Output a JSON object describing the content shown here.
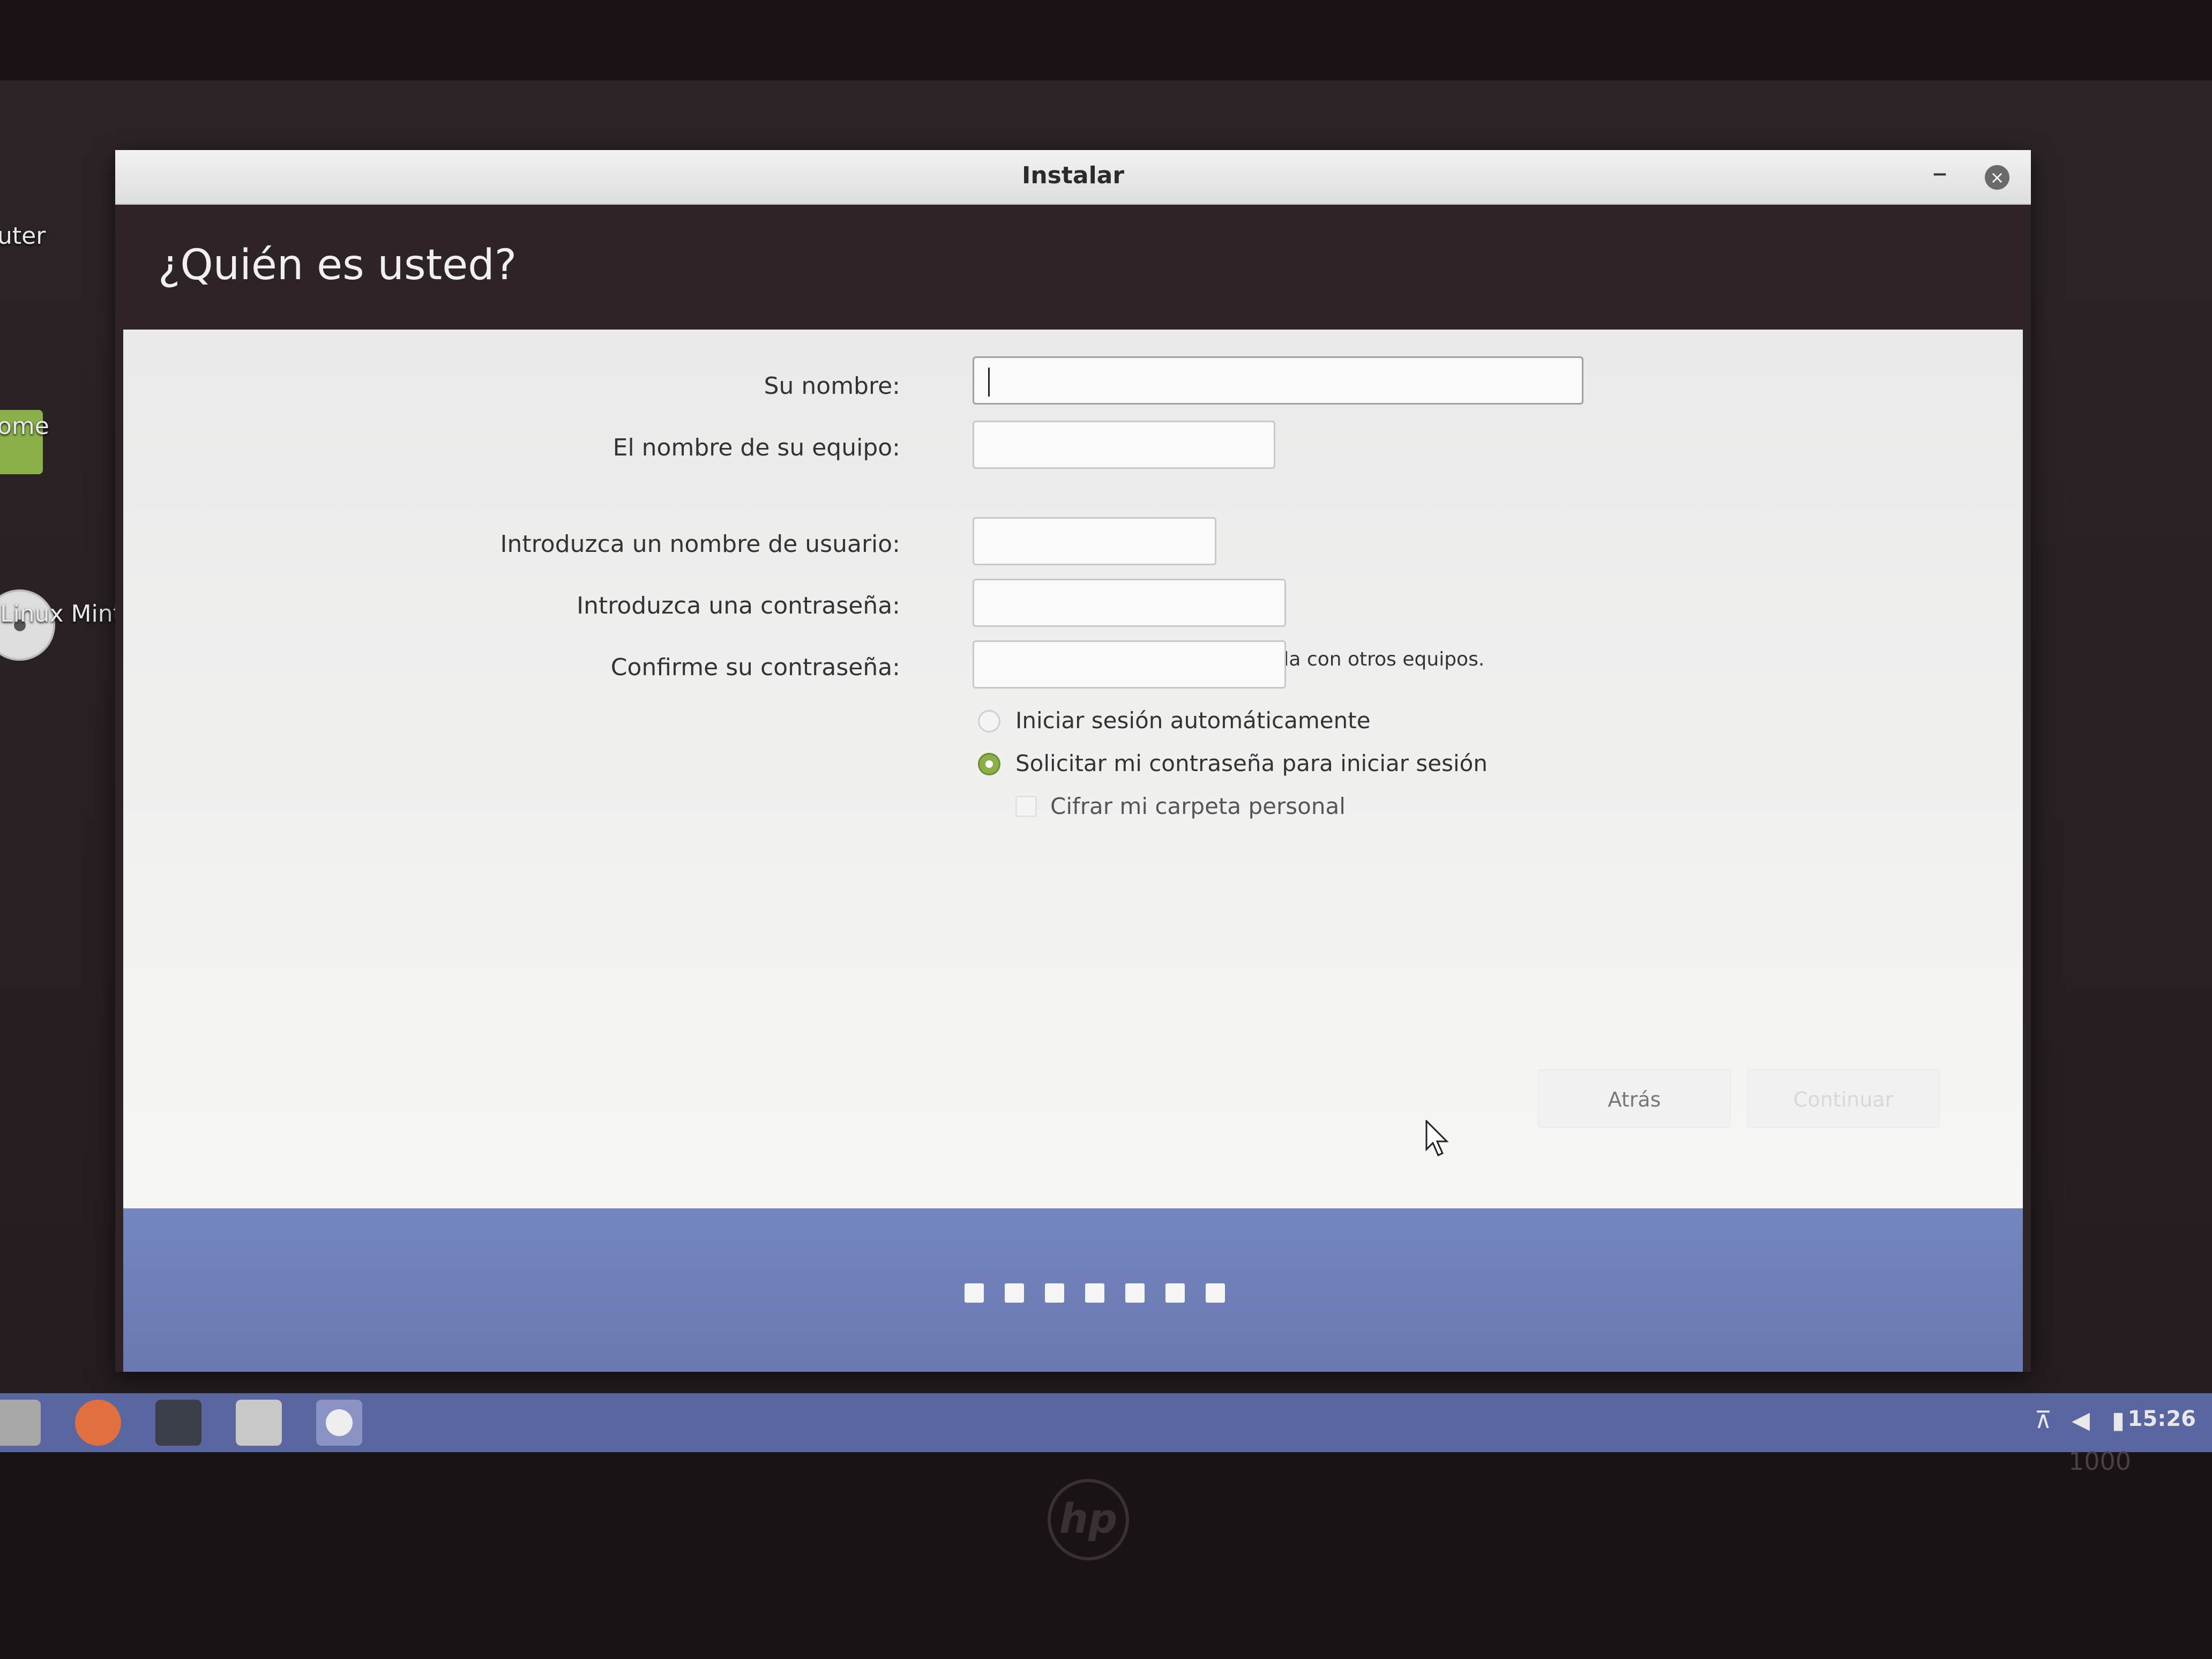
{
  "desktop": {
    "icons": [
      {
        "label": "uter"
      },
      {
        "label": "ome"
      },
      {
        "label": "Linux Mint"
      }
    ]
  },
  "window": {
    "title": "Instalar",
    "minimize_glyph": "–",
    "close_glyph": "×"
  },
  "page": {
    "heading": "¿Quién es usted?"
  },
  "form": {
    "name_label": "Su nombre:",
    "computer_label": "El nombre de su equipo:",
    "computer_hint": "El nombre que usa cuando habla con otros equipos.",
    "username_label": "Introduzca un nombre de usuario:",
    "password_label": "Introduzca una contraseña:",
    "confirm_label": "Confirme su contraseña:",
    "name_value": "",
    "computer_value": "",
    "username_value": "",
    "password_value": "",
    "confirm_value": "",
    "login_options": [
      {
        "label": "Iniciar sesión automáticamente",
        "selected": false
      },
      {
        "label": "Solicitar mi contraseña para iniciar sesión",
        "selected": true
      }
    ],
    "encrypt_label": "Cifrar mi carpeta personal",
    "encrypt_checked": false
  },
  "buttons": {
    "back": "Atrás",
    "next": "Continuar"
  },
  "progress": {
    "steps_total": 7
  },
  "taskbar": {
    "clock": "15:26",
    "items": [
      "files-icon",
      "firefox-icon",
      "terminal-icon",
      "folder-icon",
      "installer-disc-icon"
    ]
  },
  "hardware": {
    "brand": "hp",
    "model": "1000"
  },
  "colors": {
    "accent": "#8bb04a",
    "footer": "#6f80b8",
    "taskbar": "#5a66a0"
  }
}
